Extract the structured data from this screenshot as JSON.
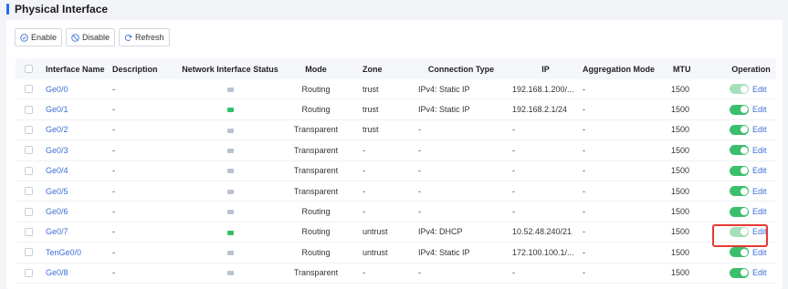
{
  "page": {
    "title": "Physical Interface"
  },
  "toolbar": {
    "enable_label": "Enable",
    "disable_label": "Disable",
    "refresh_label": "Refresh"
  },
  "table": {
    "columns": {
      "name": "Interface Name",
      "description": "Description",
      "status": "Network Interface Status",
      "mode": "Mode",
      "zone": "Zone",
      "connection": "Connection Type",
      "ip": "IP",
      "aggregation": "Aggregation Mode",
      "mtu": "MTU",
      "operation": "Operation"
    },
    "rows": [
      {
        "name": "Ge0/0",
        "description": "-",
        "status": "down",
        "mode": "Routing",
        "zone": "trust",
        "connection": "IPv4: Static IP",
        "ip": "192.168.1.200/...",
        "aggregation": "-",
        "mtu": "1500",
        "toggle": "dim",
        "edit": "Edit"
      },
      {
        "name": "Ge0/1",
        "description": "-",
        "status": "up",
        "mode": "Routing",
        "zone": "trust",
        "connection": "IPv4: Static IP",
        "ip": "192.168.2.1/24",
        "aggregation": "-",
        "mtu": "1500",
        "toggle": "on",
        "edit": "Edit"
      },
      {
        "name": "Ge0/2",
        "description": "-",
        "status": "down",
        "mode": "Transparent",
        "zone": "trust",
        "connection": "-",
        "ip": "-",
        "aggregation": "-",
        "mtu": "1500",
        "toggle": "on",
        "edit": "Edit"
      },
      {
        "name": "Ge0/3",
        "description": "-",
        "status": "down",
        "mode": "Transparent",
        "zone": "-",
        "connection": "-",
        "ip": "-",
        "aggregation": "-",
        "mtu": "1500",
        "toggle": "on",
        "edit": "Edit"
      },
      {
        "name": "Ge0/4",
        "description": "-",
        "status": "down",
        "mode": "Transparent",
        "zone": "-",
        "connection": "-",
        "ip": "-",
        "aggregation": "-",
        "mtu": "1500",
        "toggle": "on",
        "edit": "Edit"
      },
      {
        "name": "Ge0/5",
        "description": "-",
        "status": "down",
        "mode": "Transparent",
        "zone": "-",
        "connection": "-",
        "ip": "-",
        "aggregation": "-",
        "mtu": "1500",
        "toggle": "on",
        "edit": "Edit"
      },
      {
        "name": "Ge0/6",
        "description": "-",
        "status": "down",
        "mode": "Routing",
        "zone": "-",
        "connection": "-",
        "ip": "-",
        "aggregation": "-",
        "mtu": "1500",
        "toggle": "on",
        "edit": "Edit"
      },
      {
        "name": "Ge0/7",
        "description": "-",
        "status": "up",
        "mode": "Routing",
        "zone": "untrust",
        "connection": "IPv4: DHCP",
        "ip": "10.52.48.240/21",
        "aggregation": "-",
        "mtu": "1500",
        "toggle": "dim",
        "edit": "Edit"
      },
      {
        "name": "TenGe0/0",
        "description": "-",
        "status": "down",
        "mode": "Routing",
        "zone": "untrust",
        "connection": "IPv4: Static IP",
        "ip": "172.100.100.1/...",
        "aggregation": "-",
        "mtu": "1500",
        "toggle": "on",
        "edit": "Edit"
      },
      {
        "name": "Ge0/8",
        "description": "-",
        "status": "down",
        "mode": "Transparent",
        "zone": "-",
        "connection": "-",
        "ip": "-",
        "aggregation": "-",
        "mtu": "1500",
        "toggle": "on",
        "edit": "Edit"
      }
    ]
  },
  "colors": {
    "accent": "#1f6feb",
    "link": "#3b6fd6",
    "toggle_on": "#3bbf6c",
    "status_up": "#34c06a",
    "status_down": "#b9c2d0",
    "highlight": "#e53935"
  }
}
